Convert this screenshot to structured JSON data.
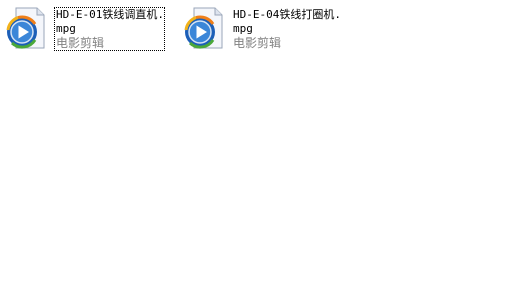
{
  "files": [
    {
      "name_line1": "HD-E-01铁线调直机.",
      "name_line2": "mpg",
      "type": "电影剪辑",
      "icon": "windows-media-player-icon",
      "selected": true
    },
    {
      "name_line1": "HD-E-04铁线打圈机.",
      "name_line2": "mpg",
      "type": "电影剪辑",
      "icon": "windows-media-player-icon",
      "selected": false
    }
  ],
  "colors": {
    "background": "#ffffff",
    "type_text": "#808080",
    "icon_ring": "#2a6fc7",
    "play_arrow": "#ffffff"
  }
}
